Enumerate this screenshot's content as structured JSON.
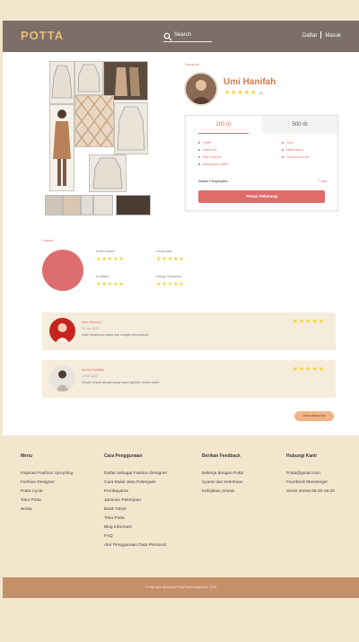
{
  "header": {
    "logo": "POTTA",
    "search_placeholder": "Search",
    "register": "Daftar",
    "login": "Masuk"
  },
  "product": {
    "designer_label": "Desainer",
    "designer_name": "Umi Hanifah",
    "stars": "★★★★★",
    "rating_count": "(5)"
  },
  "pricing": {
    "tabs": [
      "200 rb",
      "500 rb"
    ],
    "features_left": [
      "Objek",
      "Warna file",
      "High resolusi",
      "Background hitam"
    ],
    "features_right": [
      "Color",
      "Hitam/dasar",
      "Commercial use"
    ],
    "days_label": "Waktu Pengerjaan",
    "days_value": "7 hari",
    "cta": "Pesan Sekarang"
  },
  "ratings": {
    "label": "Ulasan",
    "criteria": [
      "Komunikasi",
      "Ketepatan",
      "Kualitas",
      "Harga Sepadan"
    ],
    "stars": "★★★★★"
  },
  "reviews": [
    {
      "name": "Nisa Mahmud",
      "date": "12 Jan 2023",
      "text": "Hasil desainnya bagus dan sangat memuaskan!",
      "stars": "★★★★★"
    },
    {
      "name": "Annisa Fadhilah",
      "date": "8 Feb 2023",
      "text": "Desain sesuai dengan yang saya inginkan, terima kasih",
      "stars": "★★★★★"
    }
  ],
  "more_reviews": "Lihat ulasan lain",
  "footer": {
    "menu": {
      "title": "Menu",
      "items": [
        "Inspirasi Fashion Upcycling",
        "Fashion Designer",
        "Potta Cycle",
        "Toko Potta",
        "Berita"
      ]
    },
    "cara": {
      "title": "Cara Penggunaan",
      "items": [
        "Daftar sebagai Fashion Designer",
        "Cara Mulai Jasa Pekerjaan",
        "Pembayaran",
        "Jaminan Pekerjaan",
        "Bank Tokoh",
        "Toko Potta",
        "Blog Informasi",
        "FAQ",
        "Alur Penggunaan Data Personal"
      ]
    },
    "feedback": {
      "title": "Berikan Feedback",
      "items": [
        "Bekerja dengan Potta",
        "Syarat dan ketentuan",
        "Kebijakan privasi"
      ]
    },
    "kontak": {
      "title": "Hubungi Kami",
      "items": [
        "Potta@gmail.com",
        "Facebook Messenger",
        "Senin-Jumat 08.30-18.30"
      ]
    },
    "copyright": "© Hak cipta dilindungi Potta Technologies Inc. 2023"
  },
  "colors": {
    "accent": "#df6b6b",
    "header": "#7b6f68",
    "cream": "#f2e6cc",
    "footer_bar": "#c4906a"
  }
}
